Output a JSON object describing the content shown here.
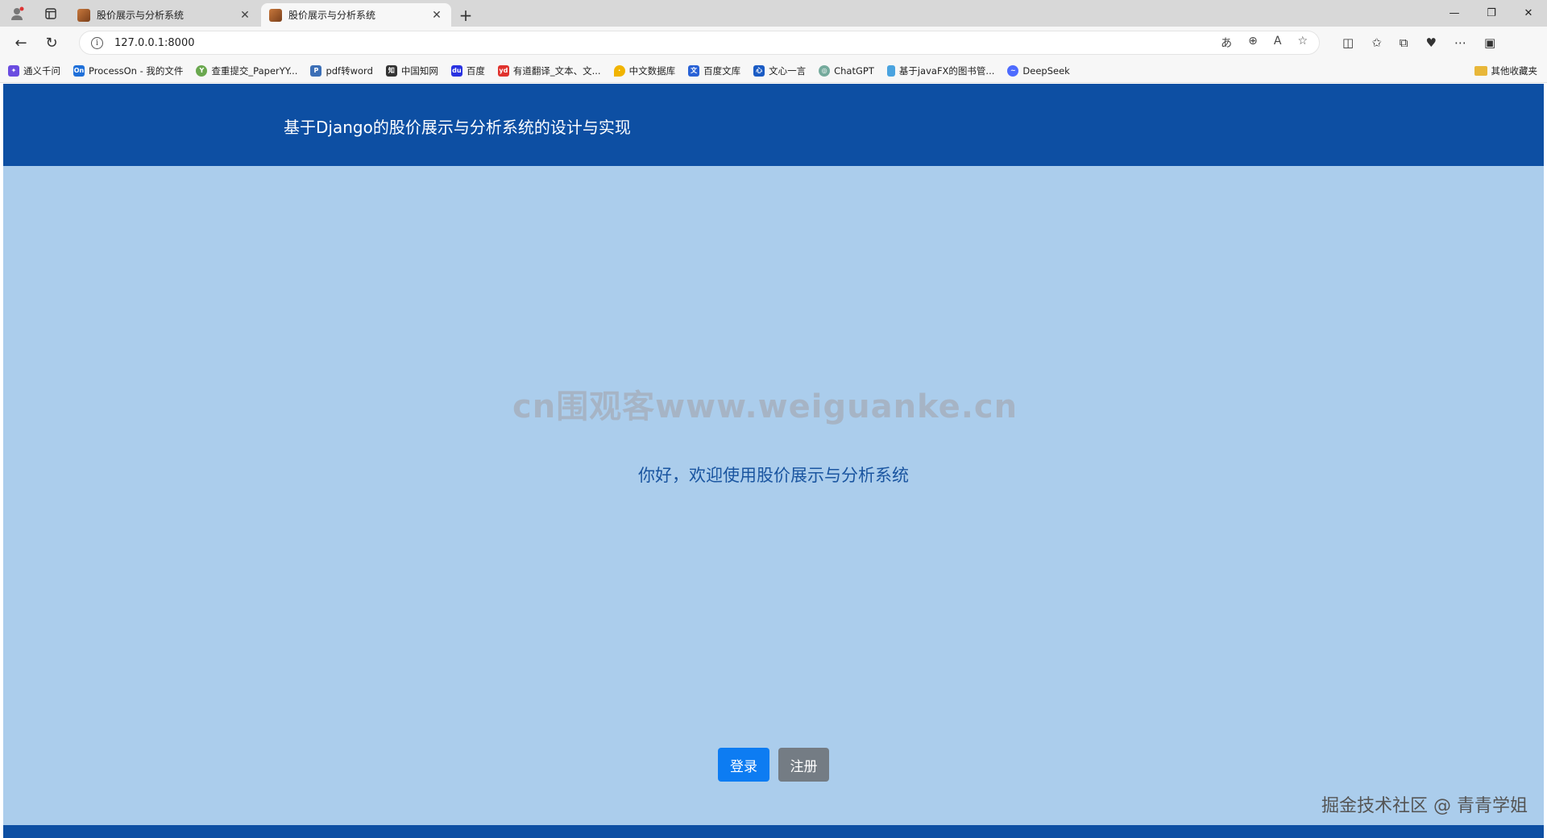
{
  "browser": {
    "tabs": [
      {
        "title": "股价展示与分析系统",
        "active": false
      },
      {
        "title": "股价展示与分析系统",
        "active": true
      }
    ],
    "url": "127.0.0.1:8000",
    "bookmarks": [
      {
        "label": "通义千问",
        "icon": "tongyi-icon",
        "color": "#6a4ce0"
      },
      {
        "label": "ProcessOn - 我的文件",
        "icon": "processon-icon",
        "color": "#1e6fd9"
      },
      {
        "label": "查重提交_PaperYY...",
        "icon": "paperyy-icon",
        "color": "#6aa84f"
      },
      {
        "label": "pdf转word",
        "icon": "pdf-icon",
        "color": "#3c6fb6"
      },
      {
        "label": "中国知网",
        "icon": "cnki-icon",
        "color": "#333333"
      },
      {
        "label": "百度",
        "icon": "baidu-icon",
        "color": "#2932e1"
      },
      {
        "label": "有道翻译_文本、文...",
        "icon": "youdao-icon",
        "color": "#e0322d"
      },
      {
        "label": "中文数据库",
        "icon": "location-icon",
        "color": "#f1b400"
      },
      {
        "label": "百度文库",
        "icon": "wenku-icon",
        "color": "#2962d6"
      },
      {
        "label": "文心一言",
        "icon": "wenxin-icon",
        "color": "#1a5bc4"
      },
      {
        "label": "ChatGPT",
        "icon": "chatgpt-icon",
        "color": "#74aa9c"
      },
      {
        "label": "基于javaFX的图书管...",
        "icon": "doc-icon",
        "color": "#4aa3df"
      },
      {
        "label": "DeepSeek",
        "icon": "deepseek-icon",
        "color": "#4d6bfe"
      }
    ],
    "other_bookmarks": "其他收藏夹"
  },
  "page": {
    "header_title": "基于Django的股价展示与分析系统的设计与实现",
    "watermark": "cn围观客www.weiguanke.cn",
    "welcome": "你好，欢迎使用股价展示与分析系统",
    "login_label": "登录",
    "register_label": "注册",
    "juejin_watermark": "掘金技术社区 @ 青青学姐"
  },
  "colors": {
    "header_bg": "#0d4fa3",
    "page_bg": "#abcdec",
    "login_btn": "#0d7cf2",
    "register_btn": "#747c84"
  }
}
